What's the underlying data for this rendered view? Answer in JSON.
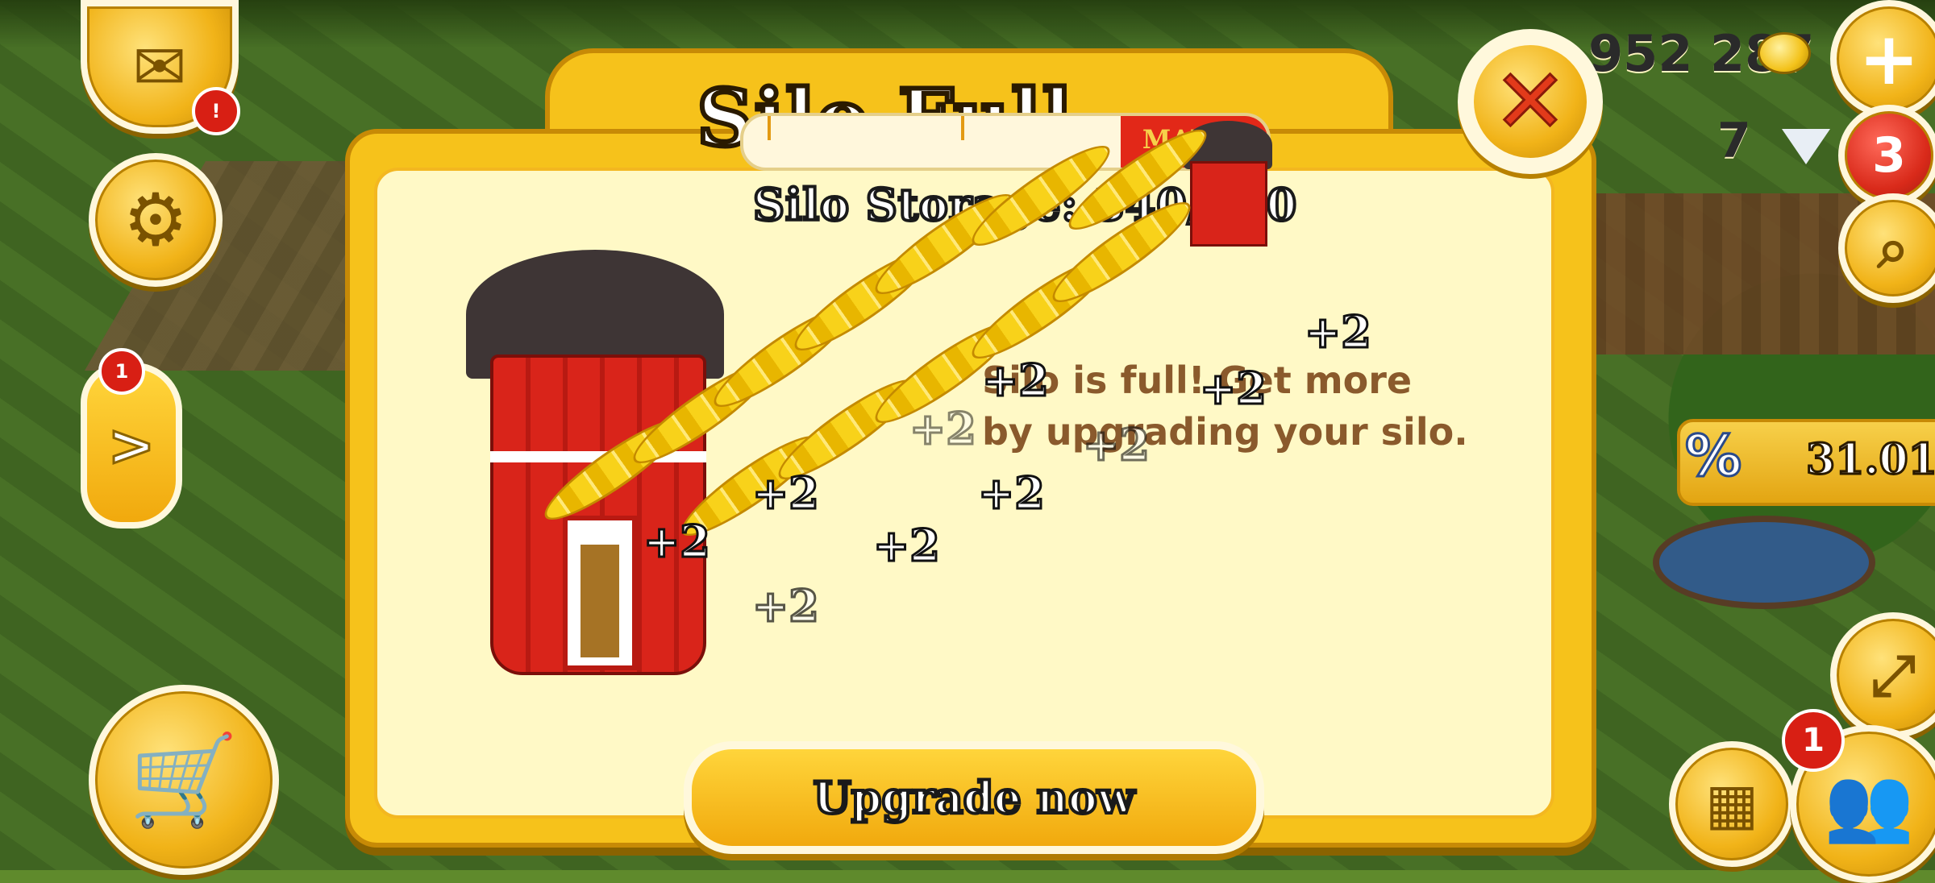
{
  "hud": {
    "coins": "952 287",
    "diamonds": "7",
    "mail_badge": "!",
    "red_badge": "3",
    "side_tab_badge": "1",
    "side_tab_arrow": ">",
    "friends_badge": "1",
    "discount_value": "31.01",
    "discount_symbol": "%",
    "add_symbol": "+"
  },
  "dialog": {
    "title": "Silo Full",
    "storage_text": "Silo Storage: 340/350",
    "max_label": "MAX",
    "message_line1": "Silo is full! Get more",
    "message_line2": "by upgrading your silo.",
    "upgrade_button": "Upgrade now",
    "close_symbol": "✕"
  },
  "rewards": [
    "+2",
    "+2",
    "+2",
    "+2",
    "+2",
    "+2",
    "+2",
    "+2",
    "+2",
    "+2"
  ],
  "colors": {
    "accent_yellow": "#f6c21b",
    "panel_cream": "#fff9c6",
    "silo_red": "#d9241a",
    "close_red": "#e23a1a"
  }
}
